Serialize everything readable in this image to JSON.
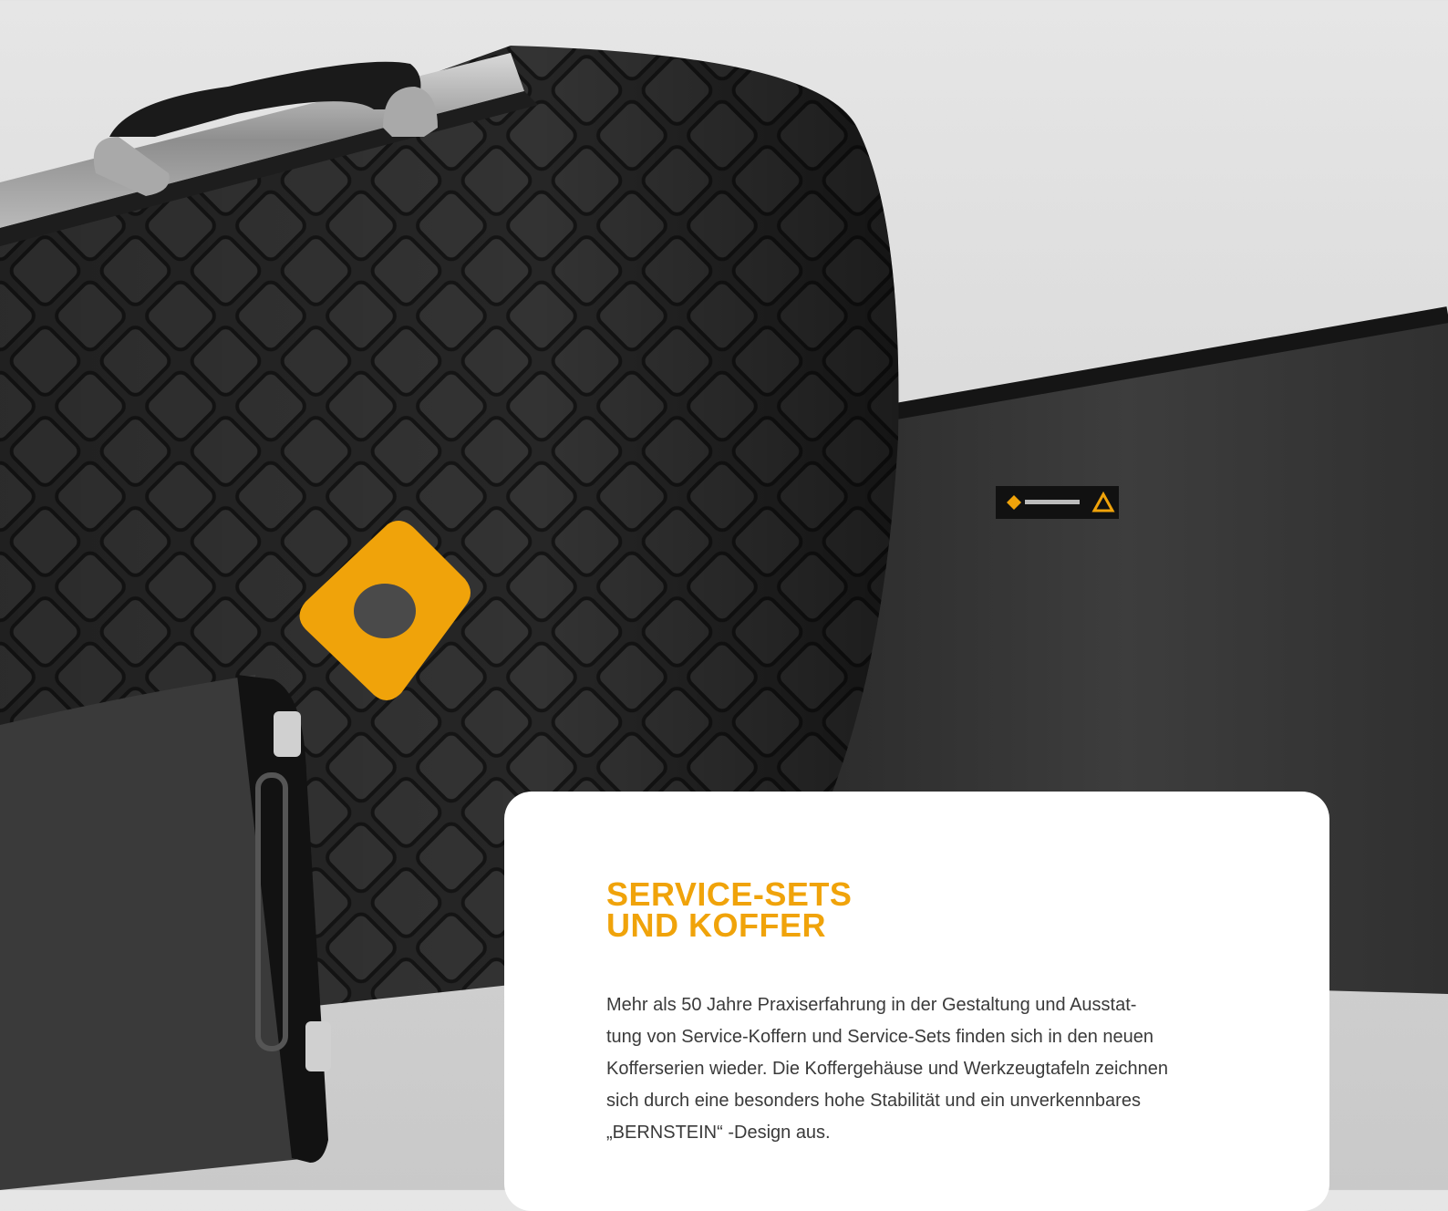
{
  "card": {
    "title_lines": [
      "SERVICE-SETS",
      "UND KOFFER"
    ],
    "body_lines": [
      "Mehr als 50 Jahre Praxiserfahrung in der Gestaltung und Ausstat-",
      "tung von Service-Koffern und Service-Sets finden sich in den neuen",
      "Kofferserien wieder. Die Koffergehäuse und Werkzeugtafeln zeichnen",
      "sich durch eine besonders hohe Stabilität und ein unverkennbares",
      "„BERNSTEIN“ -Design aus."
    ]
  },
  "colors": {
    "accent": "#f0a30a",
    "case_dark": "#2a2a2a",
    "background": "#dcdcdc"
  }
}
